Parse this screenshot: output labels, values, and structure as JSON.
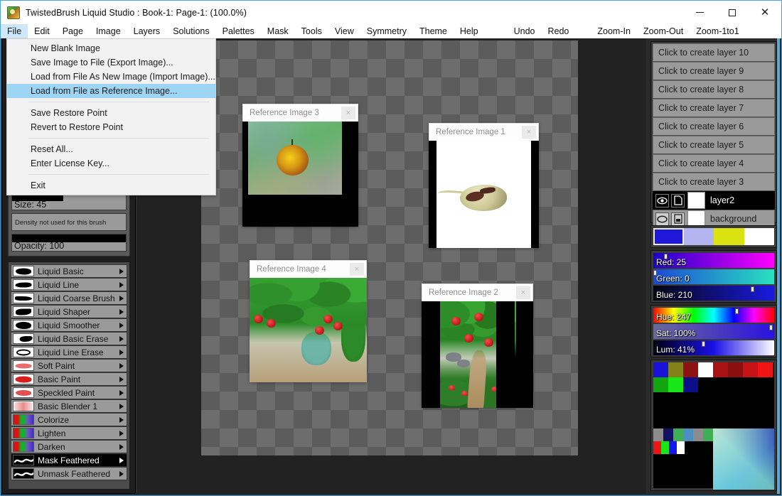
{
  "window": {
    "title": "TwistedBrush Liquid Studio : Book-1: Page-1:  (100.0%)",
    "icon": "app-icon",
    "minimize": "–",
    "maximize": "□",
    "close": "✕"
  },
  "menubar": {
    "items": [
      {
        "label": "File",
        "open": true
      },
      {
        "label": "Edit"
      },
      {
        "label": "Page"
      },
      {
        "label": "Image"
      },
      {
        "label": "Layers"
      },
      {
        "label": "Solutions"
      },
      {
        "label": "Palettes"
      },
      {
        "label": "Mask"
      },
      {
        "label": "Tools"
      },
      {
        "label": "View"
      },
      {
        "label": "Symmetry"
      },
      {
        "label": "Theme"
      },
      {
        "label": "Help"
      }
    ],
    "commands": [
      {
        "label": "Undo"
      },
      {
        "label": "Redo"
      },
      {
        "label": "Zoom-In"
      },
      {
        "label": "Zoom-Out"
      },
      {
        "label": "Zoom-1to1"
      }
    ]
  },
  "file_menu": {
    "items": [
      {
        "label": "New Blank Image",
        "selected": false,
        "sep_after": false
      },
      {
        "label": "Save Image to File (Export Image)...",
        "selected": false,
        "sep_after": false
      },
      {
        "label": "Load from File As New Image (Import Image)...",
        "selected": false,
        "sep_after": false
      },
      {
        "label": "Load from File as Reference Image...",
        "selected": true,
        "sep_after": true
      },
      {
        "label": "Save Restore Point",
        "selected": false,
        "sep_after": false
      },
      {
        "label": "Revert to Restore Point",
        "selected": false,
        "sep_after": true
      },
      {
        "label": "Reset All...",
        "selected": false,
        "sep_after": false
      },
      {
        "label": "Enter License Key...",
        "selected": false,
        "sep_after": true
      },
      {
        "label": "Exit",
        "selected": false,
        "sep_after": false
      }
    ]
  },
  "brush_settings": {
    "size_label": "Size: 45",
    "size_percent": 45,
    "density_note": "Density not used for this brush",
    "opacity_label": "Opacity: 100",
    "opacity_percent": 100
  },
  "brushes": [
    {
      "name": "Liquid Basic",
      "active": false,
      "style": "b1"
    },
    {
      "name": "Liquid Line",
      "active": false,
      "style": "b2"
    },
    {
      "name": "Liquid Coarse Brush",
      "active": false,
      "style": "b3"
    },
    {
      "name": "Liquid Shaper",
      "active": false,
      "style": "b4"
    },
    {
      "name": "Liquid Smoother",
      "active": false,
      "style": "b5"
    },
    {
      "name": "Liquid Basic Erase",
      "active": false,
      "style": "b6"
    },
    {
      "name": "Liquid Line Erase",
      "active": false,
      "style": "ring"
    },
    {
      "name": "Soft Paint",
      "active": false,
      "style": "red"
    },
    {
      "name": "Basic Paint",
      "active": false,
      "style": "red2"
    },
    {
      "name": "Speckled Paint",
      "active": false,
      "style": "speck"
    },
    {
      "name": "Basic Blender 1",
      "active": false,
      "style": "blend"
    },
    {
      "name": "Colorize",
      "active": false,
      "style": "rgb"
    },
    {
      "name": "Lighten",
      "active": false,
      "style": "rgb"
    },
    {
      "name": "Darken",
      "active": false,
      "style": "rgb"
    },
    {
      "name": "Mask Feathered",
      "active": true,
      "style": "wave"
    },
    {
      "name": "Unmask Feathered",
      "active": false,
      "style": "wave2"
    }
  ],
  "reference_windows": [
    {
      "title": "Reference Image 3",
      "close": "×",
      "art": "orange"
    },
    {
      "title": "Reference Image 1",
      "close": "×",
      "art": "mouse"
    },
    {
      "title": "Reference Image 4",
      "close": "×",
      "art": "branch"
    },
    {
      "title": "Reference Image 2",
      "close": "×",
      "art": "forest"
    }
  ],
  "layers": {
    "create_slots": [
      "Click to create layer 10",
      "Click to create layer 9",
      "Click to create layer 8",
      "Click to create layer 7",
      "Click to create layer 6",
      "Click to create layer 5",
      "Click to create layer 4",
      "Click to create layer 3"
    ],
    "existing": [
      {
        "name": "layer2",
        "active": true,
        "visibility_icon": "eye-icon",
        "mode_icon": "page-icon"
      },
      {
        "name": "background",
        "active": false,
        "visibility_icon": "ellipse-icon",
        "mode_icon": "half-page-icon"
      }
    ]
  },
  "color": {
    "swatches": [
      "#2018d8",
      "#b4b4f0",
      "#dbe212",
      "#ffffff"
    ],
    "selected_swatch_index": 0,
    "rgb": [
      {
        "label": "Red: 25",
        "value": 25,
        "percent": 10
      },
      {
        "label": "Green: 0",
        "value": 0,
        "percent": 1
      },
      {
        "label": "Blue: 210",
        "value": 210,
        "percent": 82
      }
    ],
    "hsl": [
      {
        "label": "Hue: 247",
        "value": 247,
        "percent": 69
      },
      {
        "label": "Sat: 100%",
        "value": 100,
        "percent": 97
      },
      {
        "label": "Lum: 41%",
        "value": 41,
        "percent": 41
      }
    ]
  },
  "palette": {
    "row1": [
      "#1a12d8",
      "#85811a",
      "#8d1212",
      "#ffffff",
      "#a81212",
      "#8c0f0f",
      "#c21414",
      "#f01414"
    ],
    "row2": [
      "#12a512",
      "#19e619",
      "#0d0d8c"
    ],
    "row3": [
      "#8c8c8c",
      "#121260",
      "#3fae55",
      "#4c8fc2",
      "#8c8c8c"
    ],
    "row3b": [
      "#3fae55",
      "#4c8fc2"
    ],
    "row4": [
      "#f01414",
      "#19e619",
      "#1414f0",
      "#ffffff"
    ],
    "gradient_patch": "blue-green-gradient"
  }
}
